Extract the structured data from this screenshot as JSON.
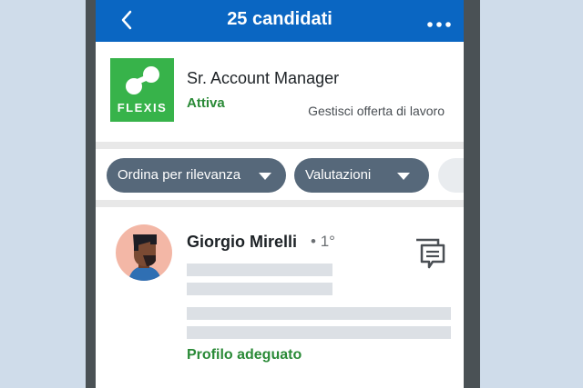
{
  "header": {
    "title": "25 candidati",
    "back_icon": "chevron-left-icon",
    "more_icon": "ellipsis-icon",
    "color": "#0a66c2"
  },
  "job": {
    "logo_text": "FLEXIS",
    "logo_color": "#37b34a",
    "title": "Sr. Account Manager",
    "status": "Attiva",
    "status_color": "#2a8a37",
    "manage_label": "Gestisci offerta di lavoro"
  },
  "filters": [
    {
      "label": "Ordina per rilevanza",
      "icon": "caret-down-icon"
    },
    {
      "label": "Valutazioni",
      "icon": "caret-down-icon"
    }
  ],
  "candidate": {
    "name": "Giorgio Mirelli",
    "separator": "•",
    "degree": "1°",
    "match": "Profilo adeguato",
    "message_icon": "message-icon"
  }
}
